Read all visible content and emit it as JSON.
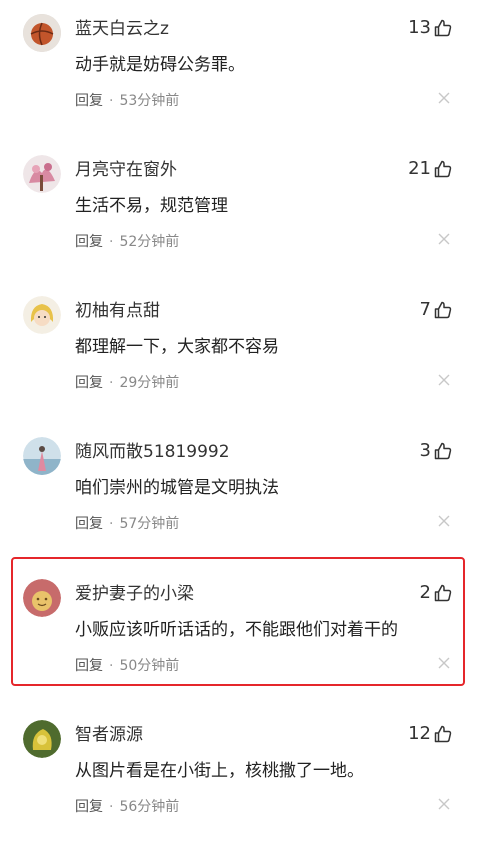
{
  "comments": [
    {
      "username": "蓝天白云之z",
      "content": "动手就是妨碍公务罪。",
      "likes": "13",
      "reply": "回复",
      "time": "53分钟前"
    },
    {
      "username": "月亮守在窗外",
      "content": "生活不易，规范管理",
      "likes": "21",
      "reply": "回复",
      "time": "52分钟前"
    },
    {
      "username": "初柚有点甜",
      "content": "都理解一下，大家都不容易",
      "likes": "7",
      "reply": "回复",
      "time": "29分钟前"
    },
    {
      "username": "随风而散51819992",
      "content": "咱们崇州的城管是文明执法",
      "likes": "3",
      "reply": "回复",
      "time": "57分钟前"
    },
    {
      "username": "爱护妻子的小梁",
      "content": "小贩应该听听话话的，不能跟他们对着干的",
      "likes": "2",
      "reply": "回复",
      "time": "50分钟前"
    },
    {
      "username": "智者源源",
      "content": "从图片看是在小街上，核桃撒了一地。",
      "likes": "12",
      "reply": "回复",
      "time": "56分钟前"
    }
  ],
  "separator": "·",
  "colors": {
    "highlight_border": "#e5262b",
    "meta_text": "#888888"
  }
}
